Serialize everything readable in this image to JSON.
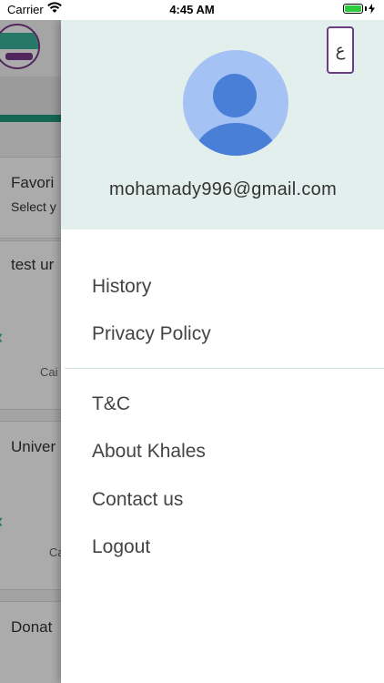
{
  "status_bar": {
    "carrier": "Carrier",
    "time": "4:45 AM"
  },
  "background": {
    "cards": [
      {
        "title": "Favori",
        "subtitle": "Select y"
      },
      {
        "title": "test ur",
        "caption": "Cai"
      },
      {
        "title": "Univer",
        "caption": "Ca"
      },
      {
        "title": "Donat"
      }
    ]
  },
  "drawer": {
    "language_toggle": "ع",
    "email": "mohamady996@gmail.com",
    "menu_group1": [
      "History",
      "Privacy Policy"
    ],
    "menu_group2": [
      "T&C",
      "About Khales",
      "Contact us",
      "Logout"
    ]
  },
  "colors": {
    "header_bg": "#e3efec",
    "accent_purple": "#6b3d86",
    "accent_green": "#1f9a7d",
    "avatar_fg": "#4a7fd8",
    "avatar_bg": "#a4c2f4"
  }
}
